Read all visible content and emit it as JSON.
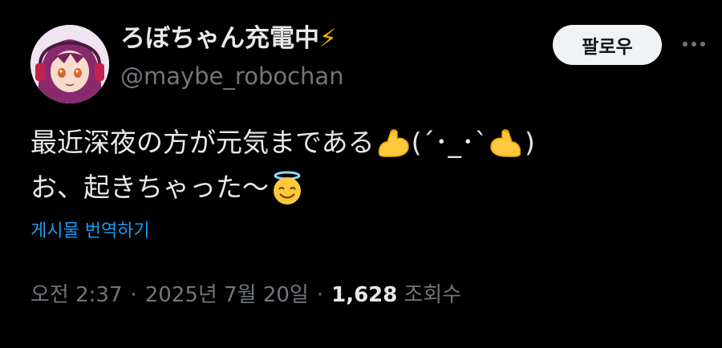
{
  "author": {
    "display_name": "ろぼちゃん充電中",
    "display_name_emoji": "⚡",
    "handle": "@maybe_robochan"
  },
  "actions": {
    "follow_label": "팔로우",
    "more_icon": "more-horizontal-icon"
  },
  "tweet": {
    "line1_text": "最近深夜の方が元気まである",
    "line1_face": "(´･_･`",
    "line1_close": ")",
    "line2_text": "お、起きちゃった〜",
    "emojis": [
      "flexed-biceps-icon",
      "flexed-biceps-icon",
      "smiling-face-with-halo-icon"
    ]
  },
  "translate": {
    "label": "게시물 번역하기"
  },
  "meta": {
    "time": "오전 2:37",
    "separator": "·",
    "date": "2025년 7월 20일",
    "views_count": "1,628",
    "views_label": "조회수"
  },
  "colors": {
    "background": "#000000",
    "text_primary": "#e7e9ea",
    "text_secondary": "#71767b",
    "link": "#1d9bf0",
    "follow_bg": "#eff3f4"
  }
}
